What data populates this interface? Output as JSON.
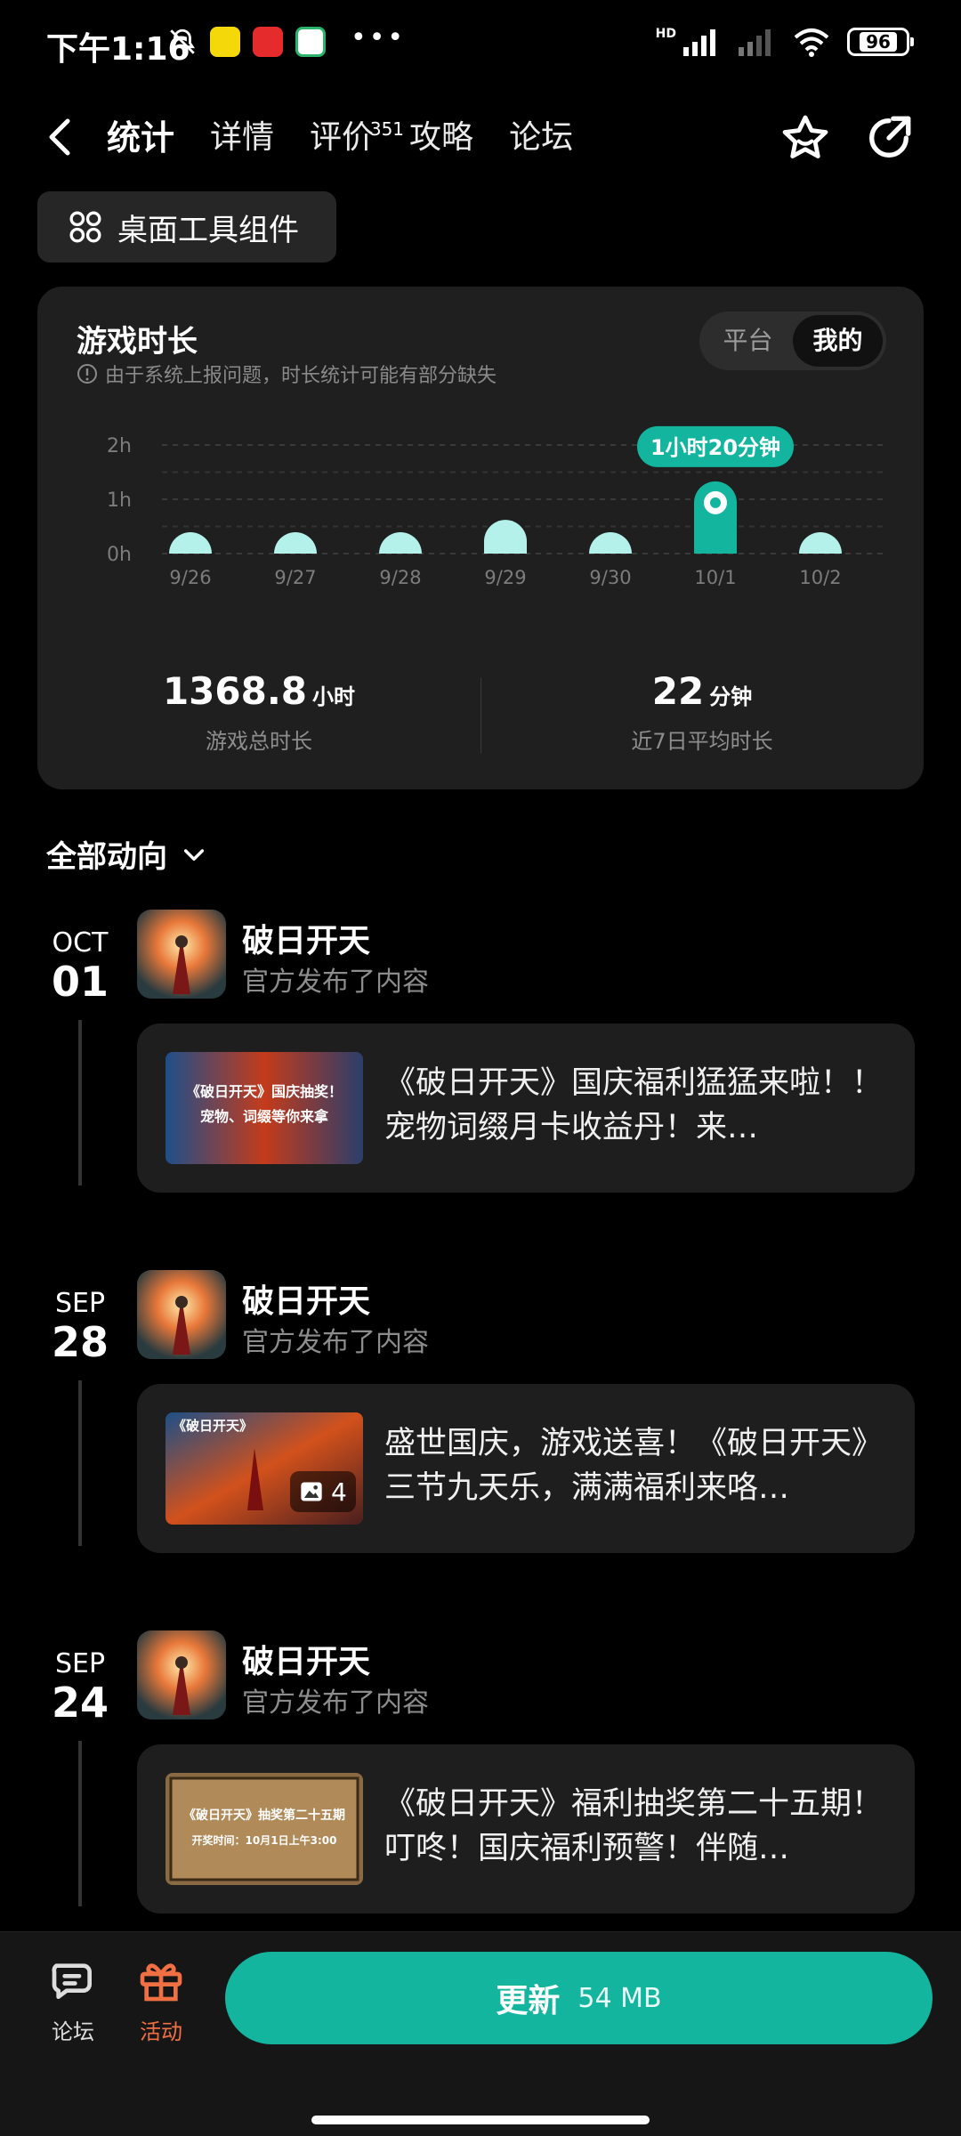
{
  "status_bar": {
    "time": "下午1:16",
    "battery": "96",
    "network": "HD"
  },
  "nav": {
    "tabs": [
      {
        "label": "统计",
        "active": true
      },
      {
        "label": "详情"
      },
      {
        "label": "评价",
        "badge": "351"
      },
      {
        "label": "攻略"
      },
      {
        "label": "论坛"
      }
    ]
  },
  "widget_button": "桌面工具组件",
  "stats": {
    "title": "游戏时长",
    "note": "由于系统上报问题，时长统计可能有部分缺失",
    "toggle": [
      "平台",
      "我的"
    ],
    "toggle_selected": "我的",
    "total_value": "1368.8",
    "total_unit": "小时",
    "total_label": "游戏总时长",
    "avg_value": "22",
    "avg_unit": "分钟",
    "avg_label": "近7日平均时长",
    "tooltip": "1小时20分钟"
  },
  "chart_data": {
    "type": "bar",
    "categories": [
      "9/26",
      "9/27",
      "9/28",
      "9/29",
      "9/30",
      "10/1",
      "10/2"
    ],
    "values": [
      0.05,
      0.05,
      0.28,
      0.62,
      0.05,
      1.33,
      0.05
    ],
    "y_ticks": [
      "0h",
      "1h",
      "2h"
    ],
    "ylim": [
      0,
      2
    ],
    "highlight_index": 5,
    "colors": {
      "bar": "#b3f1ea",
      "highlight": "#13b59f"
    }
  },
  "feed": {
    "filter_label": "全部动向",
    "items": [
      {
        "month": "OCT",
        "day": "01",
        "game": "破日开天",
        "action": "官方发布了内容",
        "text": "《破日开天》国庆福利猛猛来啦！！宠物词缀月卡收益丹！来…",
        "thumb_text": "《破日开天》国庆抽奖！宠物、词缀等你来拿"
      },
      {
        "month": "SEP",
        "day": "28",
        "game": "破日开天",
        "action": "官方发布了内容",
        "text": "盛世国庆，游戏送喜！《破日开天》三节九天乐，满满福利来咯…",
        "thumb_text": "《破日开天》",
        "image_count": "4"
      },
      {
        "month": "SEP",
        "day": "24",
        "game": "破日开天",
        "action": "官方发布了内容",
        "text": "《破日开天》福利抽奖第二十五期！ 叮咚！国庆福利预警！伴随…",
        "thumb_text": "《破日开天》抽奖第二十五期 开奖时间：10月1日上午3:00"
      }
    ]
  },
  "bottom_bar": {
    "forum_label": "论坛",
    "event_label": "活动",
    "update_label": "更新",
    "update_size": "54 MB"
  }
}
